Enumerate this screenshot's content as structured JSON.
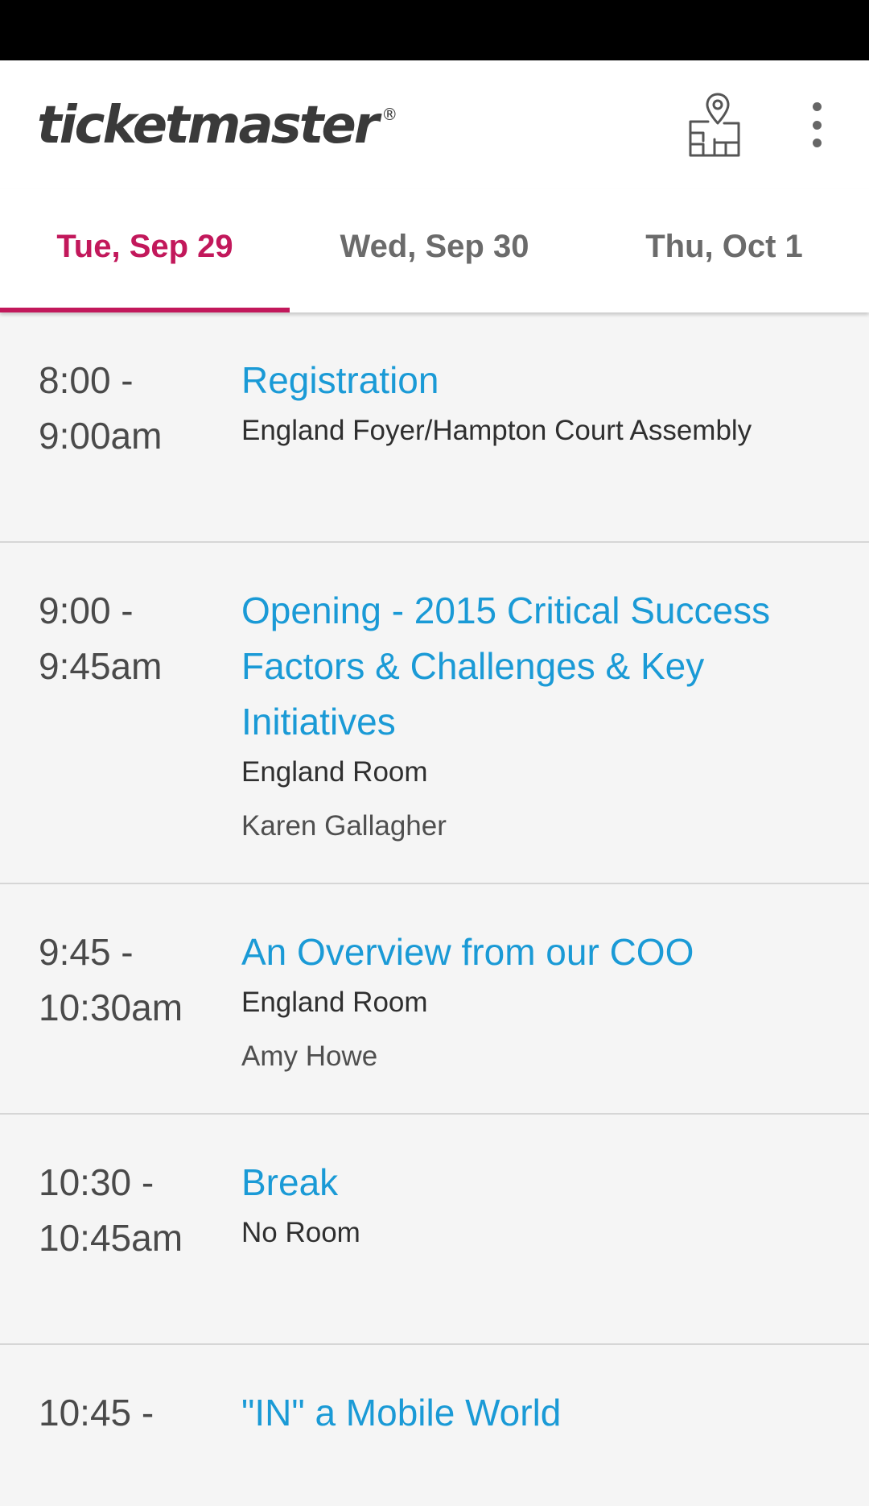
{
  "app": {
    "logo": "ticketmaster",
    "logo_mark": "®"
  },
  "toolbar": {
    "map_icon": "venue-map-icon",
    "more_icon": "more-vertical-icon"
  },
  "tabs": [
    {
      "label": "Tue, Sep 29",
      "active": true
    },
    {
      "label": "Wed, Sep 30",
      "active": false
    },
    {
      "label": "Thu, Oct 1",
      "active": false
    }
  ],
  "colors": {
    "accent": "#c2185b",
    "link": "#1a9ad6",
    "statusbar": "#000000"
  },
  "sessions": [
    {
      "time_start": "8:00 -",
      "time_end": "9:00am",
      "title": "Registration",
      "room": "England Foyer/Hampton Court Assembly",
      "speaker": ""
    },
    {
      "time_start": "9:00 -",
      "time_end": "9:45am",
      "title": "Opening - 2015 Critical Success Factors & Challenges & Key Initiatives",
      "room": "England Room",
      "speaker": "Karen Gallagher"
    },
    {
      "time_start": "9:45 -",
      "time_end": "10:30am",
      "title": "An Overview from our COO",
      "room": "England Room",
      "speaker": "Amy Howe"
    },
    {
      "time_start": "10:30 -",
      "time_end": "10:45am",
      "title": "Break",
      "room": "No Room",
      "speaker": ""
    },
    {
      "time_start": "10:45 -",
      "time_end": "",
      "title": "\"IN\" a Mobile World",
      "room": "",
      "speaker": ""
    }
  ]
}
